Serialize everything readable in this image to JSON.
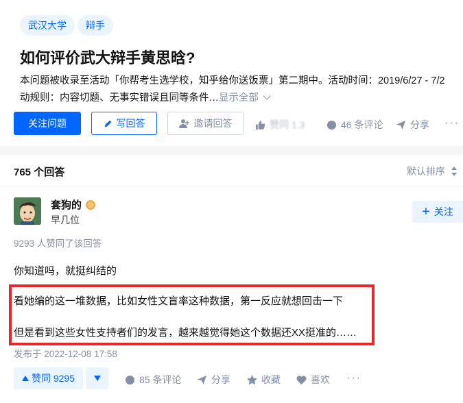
{
  "question": {
    "tags": [
      "武汉大学",
      "辩手"
    ],
    "title": "如何评价武大辩手黄思晗?",
    "description_line1": "本问题被收录至活动「你帮考生选学校，知乎给你送饭票」第二期中。活动时间：2019/6/27 - 7/2",
    "description_line2": "动规则：内容切题、无事实错误且同等条件…",
    "show_all": "显示全部",
    "actions": {
      "follow": "关注问题",
      "write": "写回答",
      "invite": "邀请回答",
      "like_blurred": "赞同 1.3",
      "comments": "46 条评论",
      "share": "分享",
      "more": "···"
    }
  },
  "answers": {
    "count_label": "765 个回答",
    "sort_label": "默认排序",
    "item": {
      "author": "套狗的",
      "headline": "早几位",
      "follow_label": "关注",
      "votes_text": "9293 人赞同了该回答",
      "paragraphs": [
        "你知道吗，就挺纠结的",
        "看她编的这一堆数据，比如女性文盲率这种数据，第一反应就想回击一下",
        "但是看到这些女性支持者们的发言，越来越觉得她这个数据还XX挺准的……"
      ],
      "published": "发布于 2022-12-08 17:58",
      "actions": {
        "upvote": "赞同 9295",
        "comments": "85 条评论",
        "share": "分享",
        "collect": "收藏",
        "like": "喜欢",
        "more": "···"
      }
    }
  },
  "colors": {
    "brand": "#0066ff",
    "highlight_border": "#e8272a",
    "muted": "#8590a6"
  }
}
